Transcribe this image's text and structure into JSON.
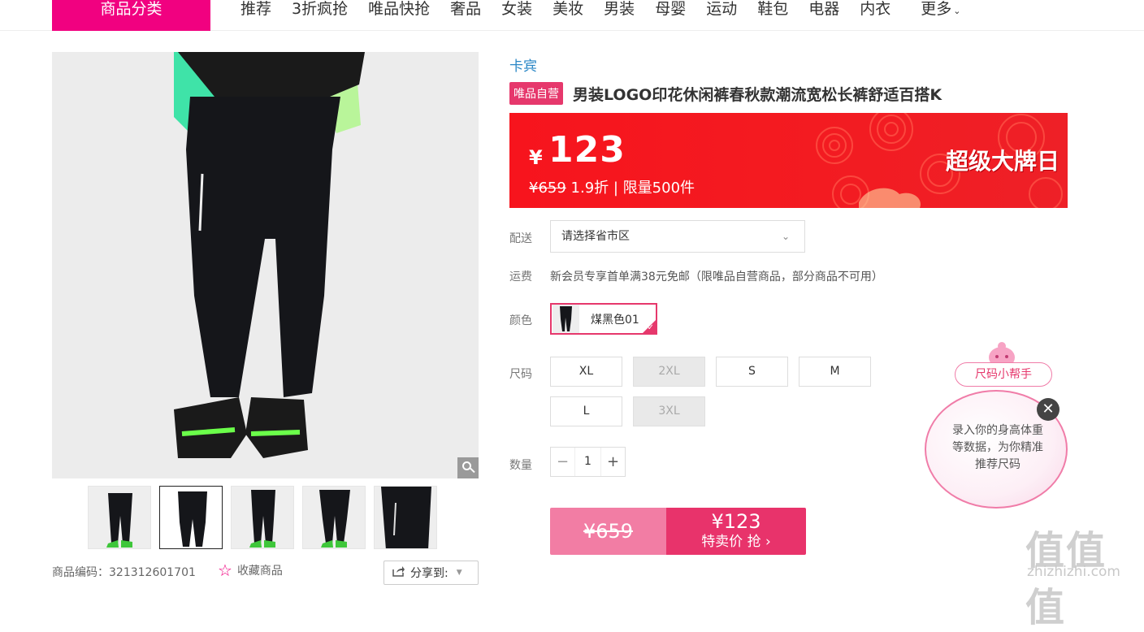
{
  "nav": {
    "category_label": "商品分类",
    "links": [
      "推荐",
      "3折疯抢",
      "唯品快抢",
      "奢品",
      "女装",
      "美妆",
      "男装",
      "母婴",
      "运动",
      "鞋包",
      "电器",
      "内衣"
    ],
    "more_label": "更多"
  },
  "product": {
    "brand": "卡宾",
    "self_badge": "唯品自营",
    "title": "男装LOGO印花休闲裤春秋款潮流宽松长裤舒适百搭K",
    "price_symbol": "¥",
    "price": "123",
    "original_price": "¥659",
    "discount_limit": "1.9折 | 限量500件",
    "event_label": "超级大牌日",
    "sku_text": "商品编码：321312601701",
    "favorite_label": "收藏商品",
    "share_label": "分享到:"
  },
  "options": {
    "delivery_label": "配送",
    "delivery_placeholder": "请选择省市区",
    "freight_label": "运费",
    "freight_text": "新会员专享首单满38元免邮（限唯品自营商品，部分商品不可用）",
    "color_label": "颜色",
    "color_value": "煤黑色01",
    "size_label": "尺码",
    "sizes": [
      {
        "label": "XL",
        "available": true
      },
      {
        "label": "2XL",
        "available": false
      },
      {
        "label": "S",
        "available": true
      },
      {
        "label": "M",
        "available": true
      },
      {
        "label": "L",
        "available": true
      },
      {
        "label": "3XL",
        "available": false
      }
    ],
    "qty_label": "数量",
    "qty_minus": "−",
    "qty_value": "1",
    "qty_plus": "+"
  },
  "buy": {
    "original_price": "¥659",
    "price": "¥123",
    "action": "特卖价 抢 ›"
  },
  "helper": {
    "tag": "尺码小帮手",
    "message": "录入你的身高体重等数据，为你精准推荐尺码",
    "close": "✕"
  },
  "watermark": {
    "logo": "值值值",
    "url": "zhizhizhi.com"
  },
  "colors": {
    "accent": "#f10180",
    "price_red": "#f7141d",
    "buy_pink": "#e8336b"
  }
}
